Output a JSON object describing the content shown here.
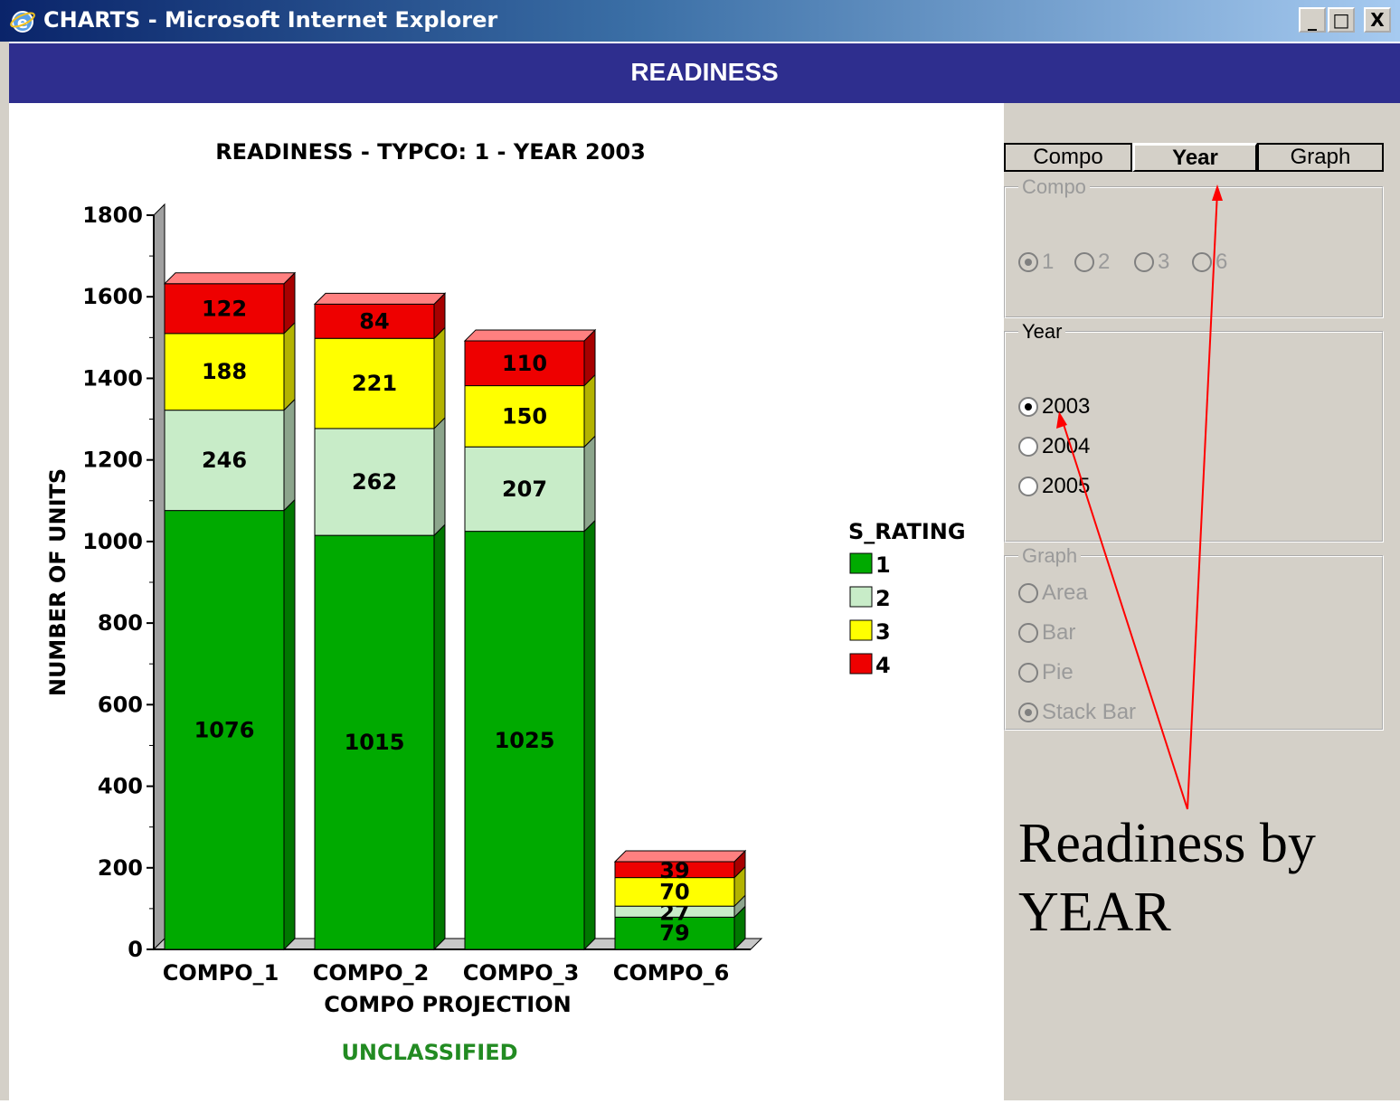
{
  "window": {
    "title": "CHARTS - Microsoft Internet Explorer",
    "icon": "ie-icon",
    "controls": [
      "_",
      "□",
      "X"
    ]
  },
  "header": {
    "title": "READINESS"
  },
  "chart": {
    "footer": "UNCLASSIFIED"
  },
  "chart_data": {
    "type": "bar",
    "stacked": true,
    "title": "READINESS - TYPCO: 1  - YEAR 2003",
    "xlabel": "COMPO PROJECTION",
    "ylabel": "NUMBER OF UNITS",
    "ylim": [
      0,
      1800
    ],
    "yticks": [
      "0",
      "200",
      "400",
      "600",
      "800",
      "1000",
      "1200",
      "1400",
      "1600",
      "1800"
    ],
    "categories": [
      "COMPO_1",
      "COMPO_2",
      "COMPO_3",
      "COMPO_6"
    ],
    "legend_title": "S_RATING",
    "series": [
      {
        "name": "1",
        "color": "#00aa00",
        "values": [
          1076,
          1015,
          1025,
          79
        ]
      },
      {
        "name": "2",
        "color": "#c8ecc8",
        "values": [
          246,
          262,
          207,
          27
        ]
      },
      {
        "name": "3",
        "color": "#ffff00",
        "values": [
          188,
          221,
          150,
          70
        ]
      },
      {
        "name": "4",
        "color": "#ee0000",
        "values": [
          122,
          84,
          110,
          39
        ]
      }
    ]
  },
  "panel": {
    "tabs": [
      {
        "label": "Compo"
      },
      {
        "label": "Year",
        "active": true
      },
      {
        "label": "Graph"
      }
    ],
    "compo_group": {
      "legend": "Compo",
      "options": [
        "1",
        "2",
        "3",
        "6"
      ],
      "selected": "1",
      "disabled": true
    },
    "year_group": {
      "legend": "Year",
      "options": [
        "2003",
        "2004",
        "2005"
      ],
      "selected": "2003"
    },
    "graph_group": {
      "legend": "Graph",
      "options": [
        "Area",
        "Bar",
        "Pie",
        "Stack Bar"
      ],
      "selected": "Stack Bar",
      "disabled": true
    }
  },
  "annotation": {
    "line1": "Readiness by",
    "line2": "YEAR",
    "arrow_color": "#ff0000"
  }
}
